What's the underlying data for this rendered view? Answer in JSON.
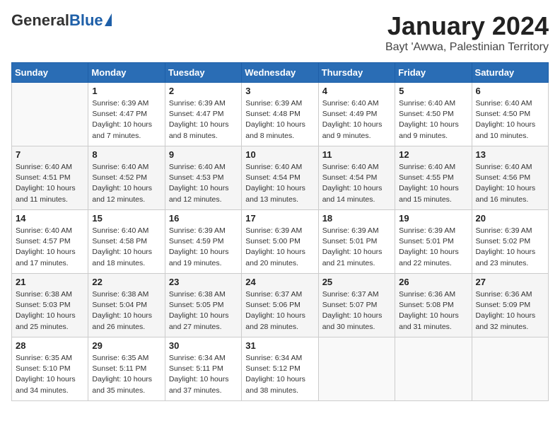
{
  "header": {
    "logo_general": "General",
    "logo_blue": "Blue",
    "month_title": "January 2024",
    "location": "Bayt 'Awwa, Palestinian Territory"
  },
  "days_of_week": [
    "Sunday",
    "Monday",
    "Tuesday",
    "Wednesday",
    "Thursday",
    "Friday",
    "Saturday"
  ],
  "weeks": [
    [
      {
        "day": "",
        "info": ""
      },
      {
        "day": "1",
        "info": "Sunrise: 6:39 AM\nSunset: 4:47 PM\nDaylight: 10 hours\nand 7 minutes."
      },
      {
        "day": "2",
        "info": "Sunrise: 6:39 AM\nSunset: 4:47 PM\nDaylight: 10 hours\nand 8 minutes."
      },
      {
        "day": "3",
        "info": "Sunrise: 6:39 AM\nSunset: 4:48 PM\nDaylight: 10 hours\nand 8 minutes."
      },
      {
        "day": "4",
        "info": "Sunrise: 6:40 AM\nSunset: 4:49 PM\nDaylight: 10 hours\nand 9 minutes."
      },
      {
        "day": "5",
        "info": "Sunrise: 6:40 AM\nSunset: 4:50 PM\nDaylight: 10 hours\nand 9 minutes."
      },
      {
        "day": "6",
        "info": "Sunrise: 6:40 AM\nSunset: 4:50 PM\nDaylight: 10 hours\nand 10 minutes."
      }
    ],
    [
      {
        "day": "7",
        "info": "Sunrise: 6:40 AM\nSunset: 4:51 PM\nDaylight: 10 hours\nand 11 minutes."
      },
      {
        "day": "8",
        "info": "Sunrise: 6:40 AM\nSunset: 4:52 PM\nDaylight: 10 hours\nand 12 minutes."
      },
      {
        "day": "9",
        "info": "Sunrise: 6:40 AM\nSunset: 4:53 PM\nDaylight: 10 hours\nand 12 minutes."
      },
      {
        "day": "10",
        "info": "Sunrise: 6:40 AM\nSunset: 4:54 PM\nDaylight: 10 hours\nand 13 minutes."
      },
      {
        "day": "11",
        "info": "Sunrise: 6:40 AM\nSunset: 4:54 PM\nDaylight: 10 hours\nand 14 minutes."
      },
      {
        "day": "12",
        "info": "Sunrise: 6:40 AM\nSunset: 4:55 PM\nDaylight: 10 hours\nand 15 minutes."
      },
      {
        "day": "13",
        "info": "Sunrise: 6:40 AM\nSunset: 4:56 PM\nDaylight: 10 hours\nand 16 minutes."
      }
    ],
    [
      {
        "day": "14",
        "info": "Sunrise: 6:40 AM\nSunset: 4:57 PM\nDaylight: 10 hours\nand 17 minutes."
      },
      {
        "day": "15",
        "info": "Sunrise: 6:40 AM\nSunset: 4:58 PM\nDaylight: 10 hours\nand 18 minutes."
      },
      {
        "day": "16",
        "info": "Sunrise: 6:39 AM\nSunset: 4:59 PM\nDaylight: 10 hours\nand 19 minutes."
      },
      {
        "day": "17",
        "info": "Sunrise: 6:39 AM\nSunset: 5:00 PM\nDaylight: 10 hours\nand 20 minutes."
      },
      {
        "day": "18",
        "info": "Sunrise: 6:39 AM\nSunset: 5:01 PM\nDaylight: 10 hours\nand 21 minutes."
      },
      {
        "day": "19",
        "info": "Sunrise: 6:39 AM\nSunset: 5:01 PM\nDaylight: 10 hours\nand 22 minutes."
      },
      {
        "day": "20",
        "info": "Sunrise: 6:39 AM\nSunset: 5:02 PM\nDaylight: 10 hours\nand 23 minutes."
      }
    ],
    [
      {
        "day": "21",
        "info": "Sunrise: 6:38 AM\nSunset: 5:03 PM\nDaylight: 10 hours\nand 25 minutes."
      },
      {
        "day": "22",
        "info": "Sunrise: 6:38 AM\nSunset: 5:04 PM\nDaylight: 10 hours\nand 26 minutes."
      },
      {
        "day": "23",
        "info": "Sunrise: 6:38 AM\nSunset: 5:05 PM\nDaylight: 10 hours\nand 27 minutes."
      },
      {
        "day": "24",
        "info": "Sunrise: 6:37 AM\nSunset: 5:06 PM\nDaylight: 10 hours\nand 28 minutes."
      },
      {
        "day": "25",
        "info": "Sunrise: 6:37 AM\nSunset: 5:07 PM\nDaylight: 10 hours\nand 30 minutes."
      },
      {
        "day": "26",
        "info": "Sunrise: 6:36 AM\nSunset: 5:08 PM\nDaylight: 10 hours\nand 31 minutes."
      },
      {
        "day": "27",
        "info": "Sunrise: 6:36 AM\nSunset: 5:09 PM\nDaylight: 10 hours\nand 32 minutes."
      }
    ],
    [
      {
        "day": "28",
        "info": "Sunrise: 6:35 AM\nSunset: 5:10 PM\nDaylight: 10 hours\nand 34 minutes."
      },
      {
        "day": "29",
        "info": "Sunrise: 6:35 AM\nSunset: 5:11 PM\nDaylight: 10 hours\nand 35 minutes."
      },
      {
        "day": "30",
        "info": "Sunrise: 6:34 AM\nSunset: 5:11 PM\nDaylight: 10 hours\nand 37 minutes."
      },
      {
        "day": "31",
        "info": "Sunrise: 6:34 AM\nSunset: 5:12 PM\nDaylight: 10 hours\nand 38 minutes."
      },
      {
        "day": "",
        "info": ""
      },
      {
        "day": "",
        "info": ""
      },
      {
        "day": "",
        "info": ""
      }
    ]
  ]
}
